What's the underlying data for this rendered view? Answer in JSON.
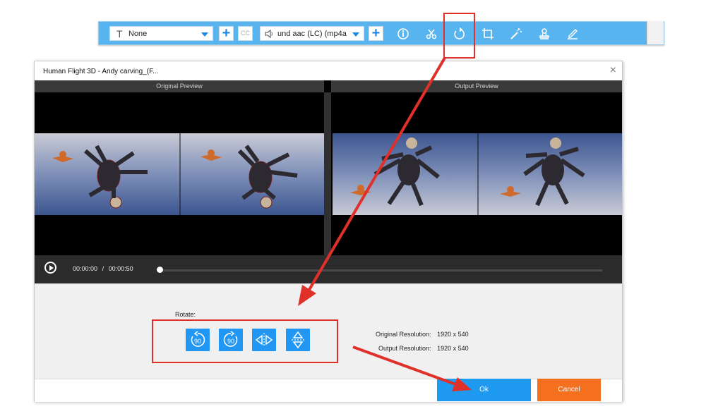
{
  "toolbar": {
    "subtitle_dropdown": {
      "icon": "text-icon",
      "value": "None"
    },
    "audio_dropdown": {
      "icon": "speaker-icon",
      "value": "und aac (LC) (mp4a"
    },
    "add_subtitle": "+",
    "add_audio": "+",
    "cc_label": "CC",
    "tools": [
      "info-icon",
      "cut-icon",
      "rotate-icon",
      "crop-icon",
      "effects-icon",
      "watermark-icon",
      "edit-icon"
    ]
  },
  "dialog": {
    "title": "Human Flight 3D - Andy carving_(F...",
    "close": "×",
    "original_preview_label": "Original Preview",
    "output_preview_label": "Output Preview",
    "time_current": "00:00:00",
    "time_sep": "/",
    "time_total": "00:00:50",
    "progress": 0,
    "rotate_label": "Rotate:",
    "rotate_buttons": [
      {
        "icon": "rotate-left-90-icon",
        "label": "90"
      },
      {
        "icon": "rotate-right-90-icon",
        "label": "90"
      },
      {
        "icon": "flip-horizontal-icon",
        "label": ""
      },
      {
        "icon": "flip-vertical-icon",
        "label": ""
      }
    ],
    "original_resolution_label": "Original Resolution:",
    "original_resolution": "1920 x 540",
    "output_resolution_label": "Output Resolution:",
    "output_resolution": "1920 x 540",
    "ok": "Ok",
    "cancel": "Cancel"
  },
  "colors": {
    "toolbar": "#58b4ee",
    "accent": "#1e9bf0",
    "cancel": "#f5701e",
    "annotation": "#e0302a"
  }
}
